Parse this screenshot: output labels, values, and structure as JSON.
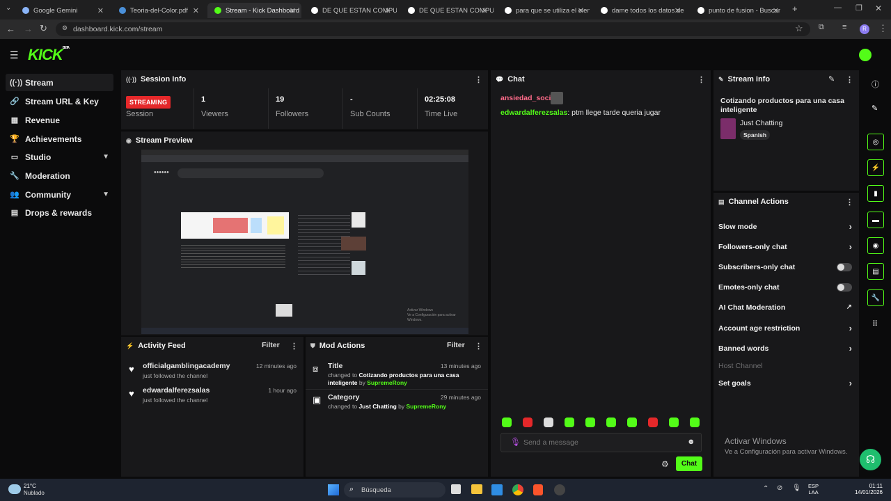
{
  "browser": {
    "tabs": [
      {
        "label": "Google Gemini",
        "color": "#8ab4f8"
      },
      {
        "label": "Teoria-del-Color.pdf",
        "color": "#4a90d9"
      },
      {
        "label": "Stream - Kick Dashboard",
        "color": "#53fc18"
      },
      {
        "label": "DE QUE ESTAN COMPUES",
        "color": "#ffffff"
      },
      {
        "label": "DE QUE ESTAN COMPUES",
        "color": "#ffffff"
      },
      {
        "label": "para que se utiliza el elem",
        "color": "#ffffff"
      },
      {
        "label": "dame todos los datos de",
        "color": "#ffffff"
      },
      {
        "label": "punto de fusion - Buscar",
        "color": "#ffffff"
      }
    ],
    "url": "dashboard.kick.com/stream",
    "profile_initial": "R"
  },
  "brand": {
    "logo": "KICK",
    "beta": "BETA",
    "accent": "#53fc18"
  },
  "sidebar": [
    {
      "label": "Stream",
      "icon": "broadcast-icon",
      "glyph": "((·))"
    },
    {
      "label": "Stream URL & Key",
      "icon": "link-icon",
      "glyph": "🔗"
    },
    {
      "label": "Revenue",
      "icon": "chart-icon",
      "glyph": "▦"
    },
    {
      "label": "Achievements",
      "icon": "trophy-icon",
      "glyph": "🏆"
    },
    {
      "label": "Studio",
      "icon": "monitor-icon",
      "glyph": "▭"
    },
    {
      "label": "Moderation",
      "icon": "wrench-icon",
      "glyph": "🔧"
    },
    {
      "label": "Community",
      "icon": "users-icon",
      "glyph": "👥"
    },
    {
      "label": "Drops & rewards",
      "icon": "grid-icon",
      "glyph": "▤"
    }
  ],
  "session": {
    "title": "Session Info",
    "status": "STREAMING",
    "status_label": "Session",
    "viewers": "1",
    "viewers_label": "Viewers",
    "followers": "19",
    "followers_label": "Followers",
    "subs": "-",
    "subs_label": "Sub Counts",
    "time": "02:25:08",
    "time_label": "Time Live"
  },
  "preview": {
    "title": "Stream Preview",
    "watermark_1": "Activar Windows",
    "watermark_2": "Ve a Configuración para activar Windows."
  },
  "activity": {
    "title": "Activity Feed",
    "filter": "Filter",
    "items": [
      {
        "user": "officialgamblingacademy",
        "action": "just followed the channel",
        "time": "12 minutes ago"
      },
      {
        "user": "edwardalferezsalas",
        "action": "just followed the channel",
        "time": "1 hour ago"
      }
    ]
  },
  "mod": {
    "title": "Mod Actions",
    "filter": "Filter",
    "items": [
      {
        "name": "Title",
        "time": "13 minutes ago",
        "prefix": "changed to",
        "value": "Cotizando productos para una casa inteligente",
        "by": "by",
        "user": "SupremeRony"
      },
      {
        "name": "Category",
        "time": "29 minutes ago",
        "prefix": "changed to",
        "value": "Just Chatting",
        "by": "by",
        "user": "SupremeRony"
      }
    ]
  },
  "chat": {
    "title": "Chat",
    "messages": [
      {
        "user": "ansiedad_social",
        "text": "",
        "color": "#ff6b8a"
      },
      {
        "user": "edwardalferezsalas",
        "text": "ptm llege tarde queria jugar",
        "color": "#53fc18"
      }
    ],
    "placeholder": "Send a message",
    "send": "Chat"
  },
  "streaminfo": {
    "title": "Stream info",
    "stream_title": "Cotizando productos para una casa inteligente",
    "category": "Just Chatting",
    "language": "Spanish"
  },
  "actions": {
    "title": "Channel Actions",
    "items": [
      {
        "label": "Slow mode",
        "kind": "arrow"
      },
      {
        "label": "Followers-only chat",
        "kind": "arrow"
      },
      {
        "label": "Subscribers-only chat",
        "kind": "toggle"
      },
      {
        "label": "Emotes-only chat",
        "kind": "toggle"
      },
      {
        "label": "AI Chat Moderation",
        "kind": "external"
      },
      {
        "label": "Account age restriction",
        "kind": "arrow"
      },
      {
        "label": "Banned words",
        "kind": "arrow"
      },
      {
        "label": "Host Channel",
        "kind": "disabled"
      },
      {
        "label": "Set goals",
        "kind": "arrow"
      }
    ]
  },
  "windows_watermark": {
    "line1": "Activar Windows",
    "line2": "Ve a Configuración para activar Windows."
  },
  "taskbar": {
    "temp": "21°C",
    "weather": "Nublado",
    "search": "Búsqueda",
    "lang1": "ESP",
    "lang2": "LAA",
    "time": "01:11",
    "date": "14/01/2026"
  }
}
